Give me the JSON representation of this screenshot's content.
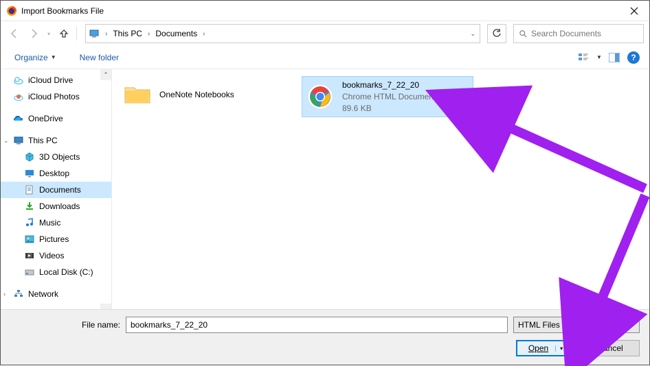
{
  "title": "Import Bookmarks File",
  "breadcrumb": [
    "This PC",
    "Documents"
  ],
  "search_placeholder": "Search Documents",
  "toolbar": {
    "organize": "Organize",
    "new_folder": "New folder"
  },
  "sidebar": {
    "items": [
      {
        "label": "iCloud Drive",
        "icon": "icloud",
        "lvl": 1
      },
      {
        "label": "iCloud Photos",
        "icon": "icloud-photos",
        "lvl": 1
      },
      {
        "label": "OneDrive",
        "icon": "onedrive",
        "lvl": 1,
        "spacer_before": true
      },
      {
        "label": "This PC",
        "icon": "thispc",
        "lvl": 1,
        "spacer_before": true,
        "expanded": true
      },
      {
        "label": "3D Objects",
        "icon": "3d",
        "lvl": 2
      },
      {
        "label": "Desktop",
        "icon": "desktop",
        "lvl": 2
      },
      {
        "label": "Documents",
        "icon": "documents",
        "lvl": 2,
        "selected": true
      },
      {
        "label": "Downloads",
        "icon": "downloads",
        "lvl": 2
      },
      {
        "label": "Music",
        "icon": "music",
        "lvl": 2
      },
      {
        "label": "Pictures",
        "icon": "pictures",
        "lvl": 2
      },
      {
        "label": "Videos",
        "icon": "videos",
        "lvl": 2
      },
      {
        "label": "Local Disk (C:)",
        "icon": "disk",
        "lvl": 2
      },
      {
        "label": "Network",
        "icon": "network",
        "lvl": 1,
        "spacer_before": true
      }
    ]
  },
  "files": [
    {
      "name": "OneNote Notebooks",
      "type": "folder"
    },
    {
      "name": "bookmarks_7_22_20",
      "type": "chrome-html",
      "sub1": "Chrome HTML Document",
      "sub2": "89.6 KB",
      "selected": true
    }
  ],
  "footer": {
    "filename_label": "File name:",
    "filename_value": "bookmarks_7_22_20",
    "filetype": "HTML Files",
    "open": "Open",
    "cancel": "Cancel"
  }
}
